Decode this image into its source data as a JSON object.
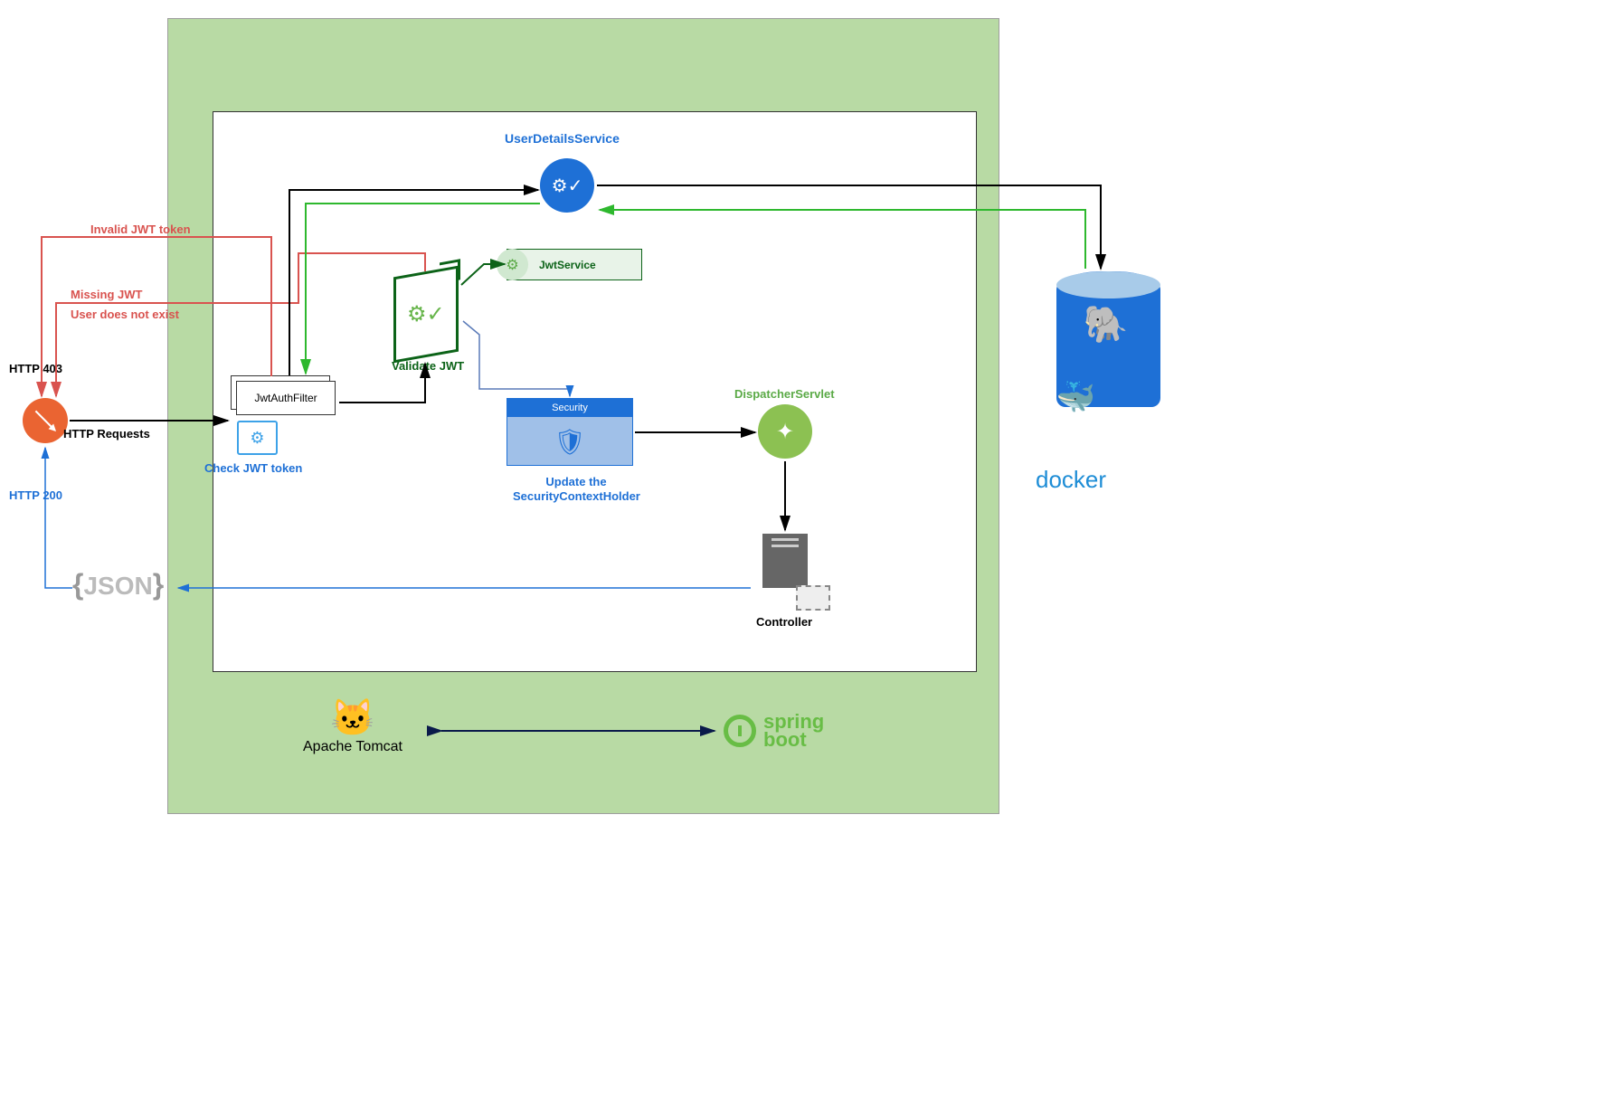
{
  "external": {
    "http403": "HTTP 403",
    "httpRequests": "HTTP Requests",
    "http200": "HTTP 200",
    "jsonLabel": "JSON"
  },
  "errors": {
    "invalidToken": "Invalid JWT token",
    "missingJwt": "Missing JWT",
    "userNotExist": "User does not exist"
  },
  "components": {
    "jwtAuthFilter": "JwtAuthFilter",
    "checkJwt": "Check JWT token",
    "validateJwt": "Validate JWT",
    "jwtService": "JwtService",
    "userDetailsService": "UserDetailsService",
    "securityHeader": "Security",
    "updateContext": "Update the SecurityContextHolder",
    "dispatcherServlet": "DispatcherServlet",
    "controller": "Controller"
  },
  "platforms": {
    "tomcat": "Apache Tomcat",
    "springTop": "spring",
    "springBottom": "boot",
    "docker": "docker"
  }
}
